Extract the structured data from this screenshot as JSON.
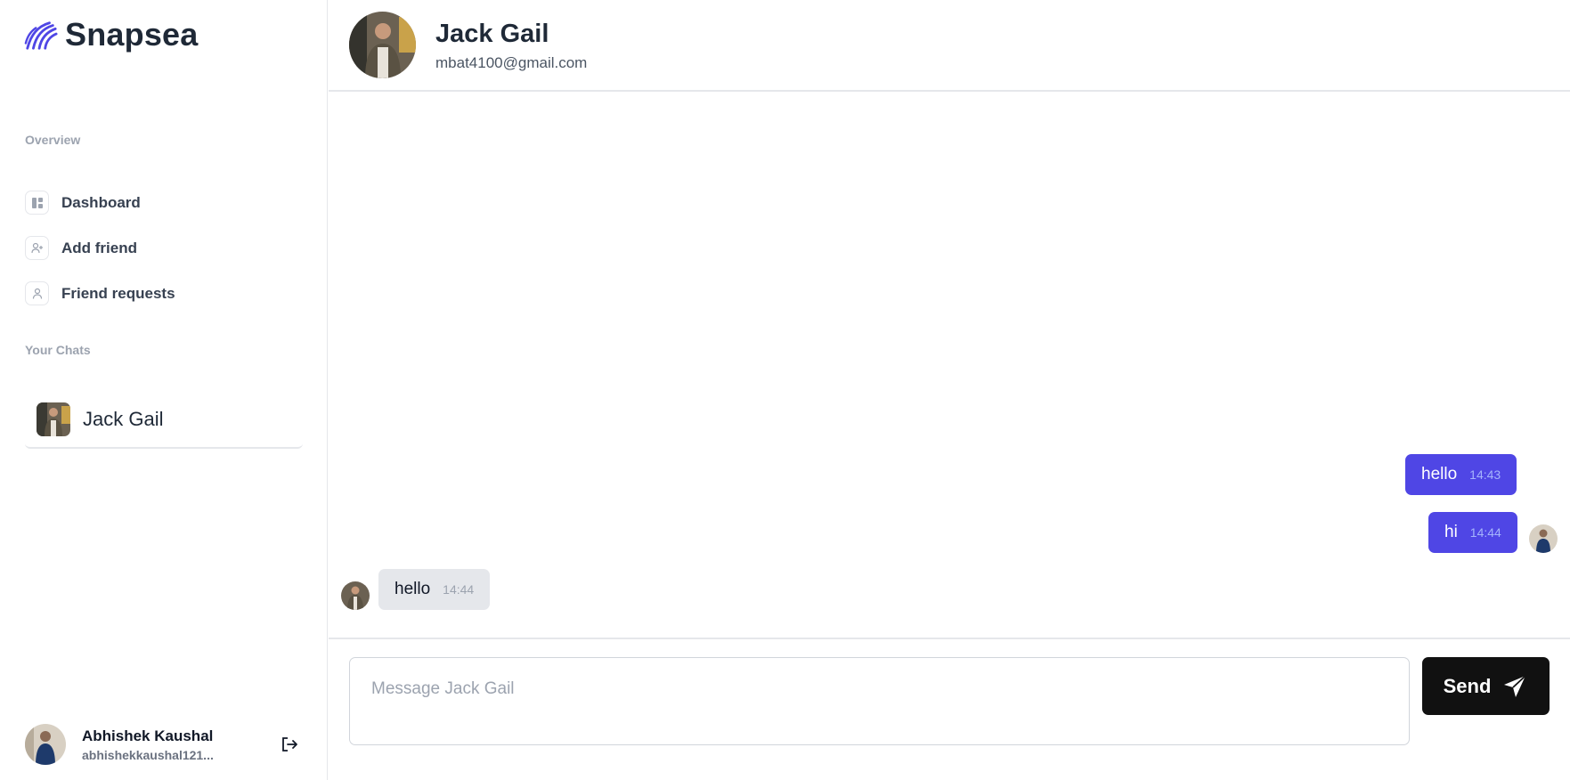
{
  "brand": {
    "name": "Snapsea",
    "accent": "#4f46e5"
  },
  "sidebar": {
    "overview_label": "Overview",
    "nav": [
      {
        "label": "Dashboard",
        "icon": "dashboard-icon"
      },
      {
        "label": "Add friend",
        "icon": "user-plus-icon"
      },
      {
        "label": "Friend requests",
        "icon": "user-icon"
      }
    ],
    "chats_label": "Your Chats",
    "chats": [
      {
        "name": "Jack Gail"
      }
    ],
    "user": {
      "name": "Abhishek Kaushal",
      "email": "abhishekkaushal121..."
    }
  },
  "chat": {
    "partner_name": "Jack Gail",
    "partner_email": "mbat4100@gmail.com",
    "messages": [
      {
        "text": "hello",
        "time": "14:43",
        "direction": "sent"
      },
      {
        "text": "hi",
        "time": "14:44",
        "direction": "sent"
      },
      {
        "text": "hello",
        "time": "14:44",
        "direction": "received"
      }
    ],
    "input_placeholder": "Message Jack Gail",
    "send_label": "Send"
  },
  "colors": {
    "sent_bubble": "#4f46e5",
    "received_bubble": "#e5e7eb",
    "send_button": "#111111"
  }
}
